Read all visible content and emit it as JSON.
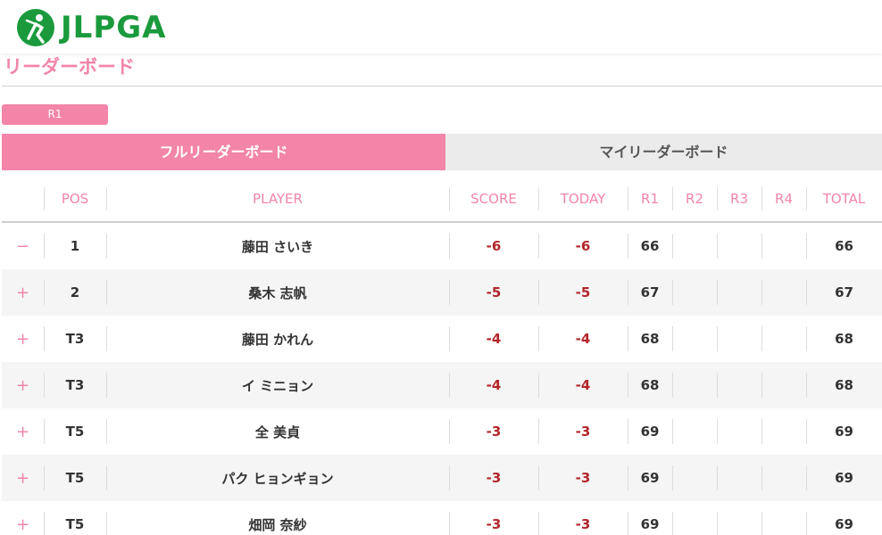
{
  "colors": {
    "accent_pink": "#f285a8",
    "logo_green": "#1a9a3c",
    "under_par_red": "#b3262c",
    "tab_inactive_bg": "#ebebeb",
    "row_alt_bg": "#f5f5f5"
  },
  "logo": {
    "text": "JLPGA",
    "icon": "golfer-logo-icon"
  },
  "page_title": "リーダーボード",
  "round_select": {
    "value": "R1"
  },
  "tabs": [
    {
      "label": "フルリーダーボード",
      "active": true
    },
    {
      "label": "マイリーダーボード",
      "active": false
    }
  ],
  "columns": {
    "pos": "POS",
    "player": "PLAYER",
    "score": "SCORE",
    "today": "TODAY",
    "r1": "R1",
    "r2": "R2",
    "r3": "R3",
    "r4": "R4",
    "total": "TOTAL"
  },
  "rows": [
    {
      "toggle": "−",
      "pos": "1",
      "player": "藤田 さいき",
      "score": "-6",
      "today": "-6",
      "r1": "66",
      "r2": "",
      "r3": "",
      "r4": "",
      "total": "66"
    },
    {
      "toggle": "+",
      "pos": "2",
      "player": "桑木 志帆",
      "score": "-5",
      "today": "-5",
      "r1": "67",
      "r2": "",
      "r3": "",
      "r4": "",
      "total": "67"
    },
    {
      "toggle": "+",
      "pos": "T3",
      "player": "藤田 かれん",
      "score": "-4",
      "today": "-4",
      "r1": "68",
      "r2": "",
      "r3": "",
      "r4": "",
      "total": "68"
    },
    {
      "toggle": "+",
      "pos": "T3",
      "player": "イ ミニョン",
      "score": "-4",
      "today": "-4",
      "r1": "68",
      "r2": "",
      "r3": "",
      "r4": "",
      "total": "68"
    },
    {
      "toggle": "+",
      "pos": "T5",
      "player": "全 美貞",
      "score": "-3",
      "today": "-3",
      "r1": "69",
      "r2": "",
      "r3": "",
      "r4": "",
      "total": "69"
    },
    {
      "toggle": "+",
      "pos": "T5",
      "player": "パク ヒョンギョン",
      "score": "-3",
      "today": "-3",
      "r1": "69",
      "r2": "",
      "r3": "",
      "r4": "",
      "total": "69"
    },
    {
      "toggle": "+",
      "pos": "T5",
      "player": "畑岡 奈紗",
      "score": "-3",
      "today": "-3",
      "r1": "69",
      "r2": "",
      "r3": "",
      "r4": "",
      "total": "69"
    }
  ]
}
